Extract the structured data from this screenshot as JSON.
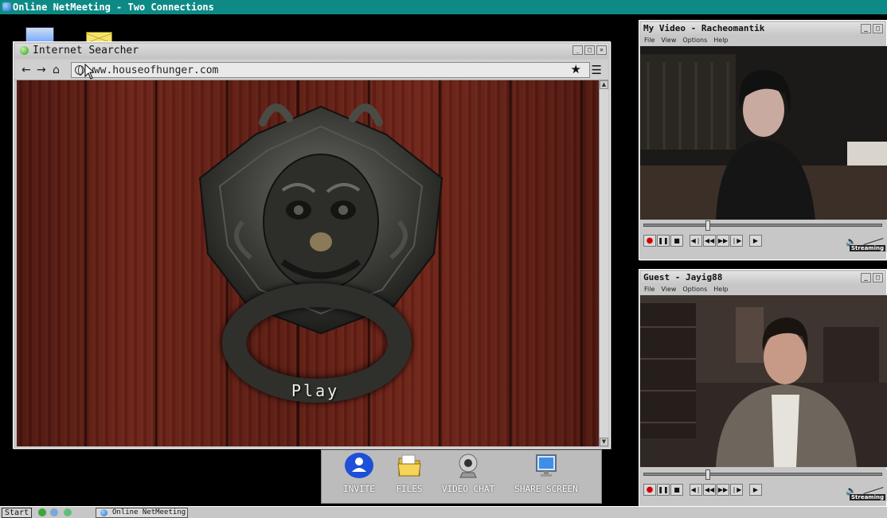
{
  "app": {
    "title": "Online NetMeeting - Two Connections"
  },
  "browser": {
    "title": "Internet Searcher",
    "url": "www.houseofhunger.com",
    "content": {
      "play_label": "Play"
    },
    "controls": {
      "minimize": "_",
      "maximize": "□",
      "close": "✕"
    }
  },
  "toolbar": {
    "items": [
      {
        "label": "INVITE",
        "icon": "user-icon"
      },
      {
        "label": "FILES",
        "icon": "folder-icon"
      },
      {
        "label": "VIDEO CHAT",
        "icon": "webcam-icon"
      },
      {
        "label": "SHARE SCREEN",
        "icon": "monitor-icon"
      }
    ]
  },
  "video_windows": [
    {
      "title": "My Video - Racheomantik",
      "menu": [
        "File",
        "View",
        "Options",
        "Help"
      ],
      "status": "Streaming",
      "progress": 0.26
    },
    {
      "title": "Guest - Jayig88",
      "menu": [
        "File",
        "View",
        "Options",
        "Help"
      ],
      "status": "Streaming",
      "progress": 0.26
    }
  ],
  "taskbar": {
    "start_label": "Start",
    "task_label": "Online NetMeeting"
  },
  "colors": {
    "titlebar": "#0e8a86",
    "window_chrome": "#c7c7c7",
    "invite_accent": "#1d4fd8"
  }
}
